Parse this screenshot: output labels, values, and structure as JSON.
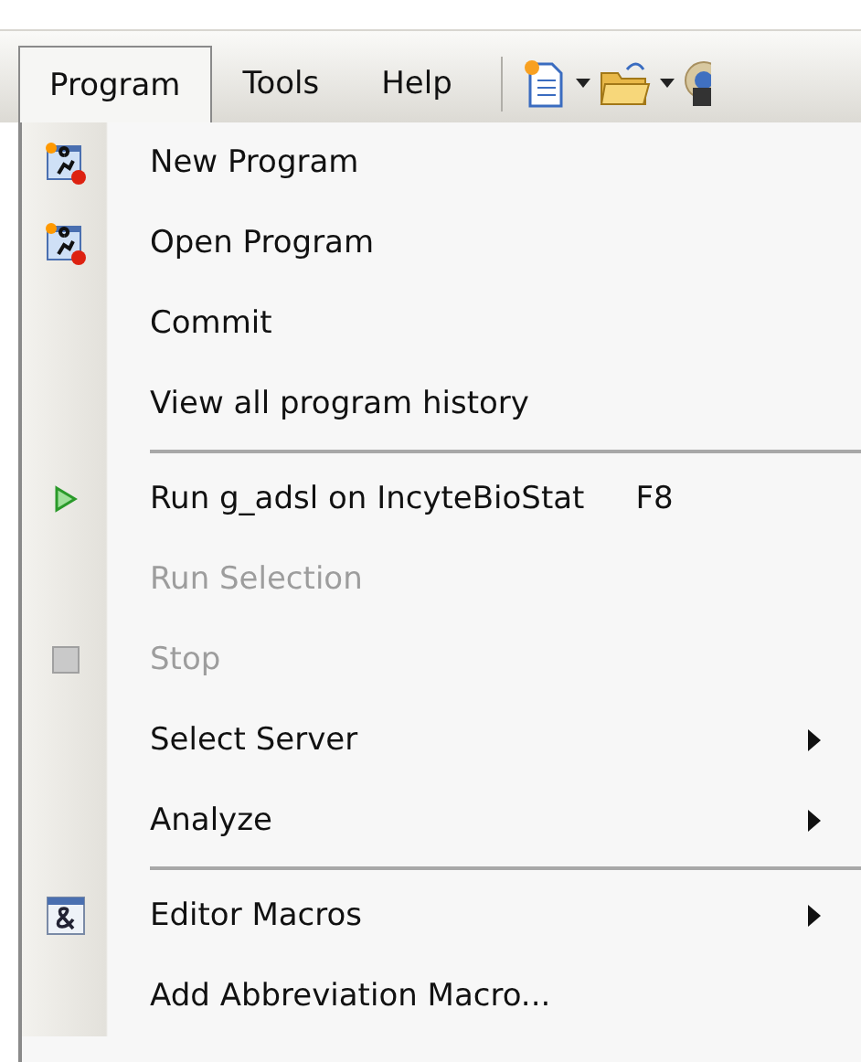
{
  "menubar": [
    {
      "label": "Program",
      "selected": true
    },
    {
      "label": "Tools",
      "selected": false
    },
    {
      "label": "Help",
      "selected": false
    }
  ],
  "menu": [
    {
      "kind": "program",
      "label": "New Program",
      "disabled": false,
      "submenu": false
    },
    {
      "kind": "program",
      "label": "Open Program",
      "disabled": false,
      "submenu": false
    },
    {
      "kind": "plain",
      "label": "Commit",
      "disabled": false,
      "submenu": false
    },
    {
      "kind": "plain",
      "label": "View all program history",
      "disabled": false,
      "submenu": false
    },
    {
      "kind": "separator"
    },
    {
      "kind": "run",
      "label": "Run g_adsl on IncyteBioStat",
      "shortcut": "F8",
      "disabled": false,
      "submenu": false
    },
    {
      "kind": "plain",
      "label": "Run Selection",
      "disabled": true,
      "submenu": false
    },
    {
      "kind": "stop",
      "label": "Stop",
      "disabled": true,
      "submenu": false
    },
    {
      "kind": "plain",
      "label": "Select Server",
      "disabled": false,
      "submenu": true
    },
    {
      "kind": "plain",
      "label": "Analyze",
      "disabled": false,
      "submenu": true
    },
    {
      "kind": "separator"
    },
    {
      "kind": "macro",
      "label": "Editor Macros",
      "disabled": false,
      "submenu": true
    },
    {
      "kind": "plain",
      "label": "Add Abbreviation Macro...",
      "disabled": false,
      "submenu": false
    }
  ]
}
